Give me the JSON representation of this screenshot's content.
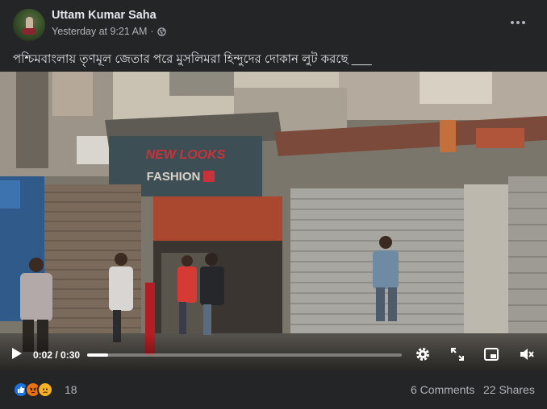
{
  "post": {
    "author": "Uttam Kumar Saha",
    "timestamp": "Yesterday at 9:21 AM",
    "separator": "·",
    "privacy_icon": "globe-icon",
    "more_icon": "more-horizontal-icon",
    "caption": "পশ্চিমবাংলায় তৃণমূল জেতার পরে মুসলিমরা হিন্দুদের দোকান লুট করছে ___"
  },
  "video": {
    "time_current": "0:02",
    "time_total": "0:30",
    "time_display": "0:02 / 0:30",
    "progress_fraction": 0.067,
    "shop_sign": "FASHION",
    "controls": [
      "play-icon",
      "settings-icon",
      "fullscreen-icon",
      "picture-in-picture-icon",
      "volume-muted-icon"
    ]
  },
  "footer": {
    "reactions": [
      "like",
      "angry",
      "sad"
    ],
    "reaction_count": "18",
    "comments": "6 Comments",
    "shares": "22 Shares"
  },
  "colors": {
    "background": "#242526",
    "text_primary": "#e4e6eb",
    "text_secondary": "#b0b3b8",
    "like": "#1b74e4",
    "angry": "#e9710f",
    "sad": "#f7b125"
  }
}
